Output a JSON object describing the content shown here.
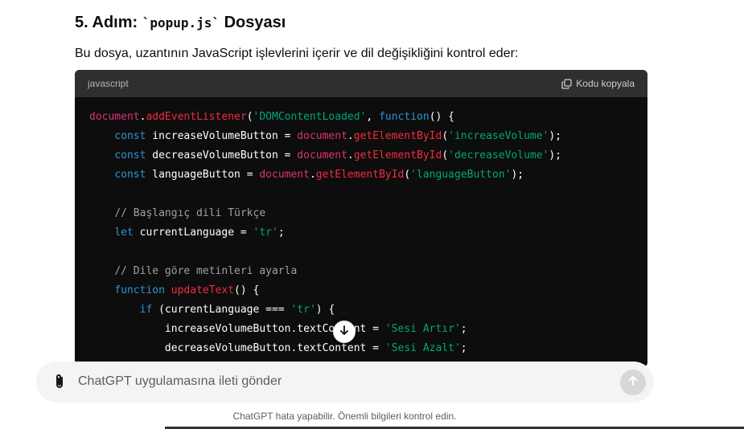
{
  "heading": {
    "prefix": "5. Adım: ",
    "code": "`popup.js`",
    "suffix": " Dosyası"
  },
  "paragraph": "Bu dosya, uzantının JavaScript işlevlerini içerir ve dil değişikliğini kontrol eder:",
  "code_block": {
    "language": "javascript",
    "copy_label": "Kodu kopyala",
    "lines": [
      [
        [
          "obj",
          "document"
        ],
        [
          "op",
          "."
        ],
        [
          "fn",
          "addEventListener"
        ],
        [
          "op",
          "("
        ],
        [
          "str",
          "'DOMContentLoaded'"
        ],
        [
          "op",
          ", "
        ],
        [
          "kw",
          "function"
        ],
        [
          "op",
          "() {"
        ]
      ],
      [
        [
          "op",
          "    "
        ],
        [
          "kw",
          "const"
        ],
        [
          "ident",
          " increaseVolumeButton "
        ],
        [
          "op",
          "= "
        ],
        [
          "obj",
          "document"
        ],
        [
          "op",
          "."
        ],
        [
          "fn",
          "getElementById"
        ],
        [
          "op",
          "("
        ],
        [
          "str",
          "'increaseVolume'"
        ],
        [
          "op",
          ");"
        ]
      ],
      [
        [
          "op",
          "    "
        ],
        [
          "kw",
          "const"
        ],
        [
          "ident",
          " decreaseVolumeButton "
        ],
        [
          "op",
          "= "
        ],
        [
          "obj",
          "document"
        ],
        [
          "op",
          "."
        ],
        [
          "fn",
          "getElementById"
        ],
        [
          "op",
          "("
        ],
        [
          "str",
          "'decreaseVolume'"
        ],
        [
          "op",
          ");"
        ]
      ],
      [
        [
          "op",
          "    "
        ],
        [
          "kw",
          "const"
        ],
        [
          "ident",
          " languageButton "
        ],
        [
          "op",
          "= "
        ],
        [
          "obj",
          "document"
        ],
        [
          "op",
          "."
        ],
        [
          "fn",
          "getElementById"
        ],
        [
          "op",
          "("
        ],
        [
          "str",
          "'languageButton'"
        ],
        [
          "op",
          ");"
        ]
      ],
      [],
      [
        [
          "op",
          "    "
        ],
        [
          "cm",
          "// Başlangıç dili Türkçe"
        ]
      ],
      [
        [
          "op",
          "    "
        ],
        [
          "kw",
          "let"
        ],
        [
          "ident",
          " currentLanguage "
        ],
        [
          "op",
          "= "
        ],
        [
          "str",
          "'tr'"
        ],
        [
          "op",
          ";"
        ]
      ],
      [],
      [
        [
          "op",
          "    "
        ],
        [
          "cm",
          "// Dile göre metinleri ayarla"
        ]
      ],
      [
        [
          "op",
          "    "
        ],
        [
          "kw",
          "function"
        ],
        [
          "op",
          " "
        ],
        [
          "fn",
          "updateText"
        ],
        [
          "op",
          "() {"
        ]
      ],
      [
        [
          "op",
          "        "
        ],
        [
          "kw",
          "if"
        ],
        [
          "op",
          " ("
        ],
        [
          "ident",
          "currentLanguage "
        ],
        [
          "op",
          "=== "
        ],
        [
          "str",
          "'tr'"
        ],
        [
          "op",
          ") {"
        ]
      ],
      [
        [
          "op",
          "            "
        ],
        [
          "ident",
          "increaseVolumeButton.textContent "
        ],
        [
          "op",
          "= "
        ],
        [
          "str",
          "'Sesi Artır'"
        ],
        [
          "op",
          ";"
        ]
      ],
      [
        [
          "op",
          "            "
        ],
        [
          "ident",
          "decreaseVolumeButton.textContent "
        ],
        [
          "op",
          "= "
        ],
        [
          "str",
          "'Sesi Azalt'"
        ],
        [
          "op",
          ";"
        ]
      ]
    ]
  },
  "composer": {
    "placeholder": "ChatGPT uygulamasına ileti gönder"
  },
  "footer": "ChatGPT hata yapabilir. Önemli bilgileri kontrol edin.",
  "icons": {
    "copy": "copy-icon",
    "scroll": "arrow-down-icon",
    "attach": "paperclip-icon",
    "send": "arrow-up-icon"
  }
}
